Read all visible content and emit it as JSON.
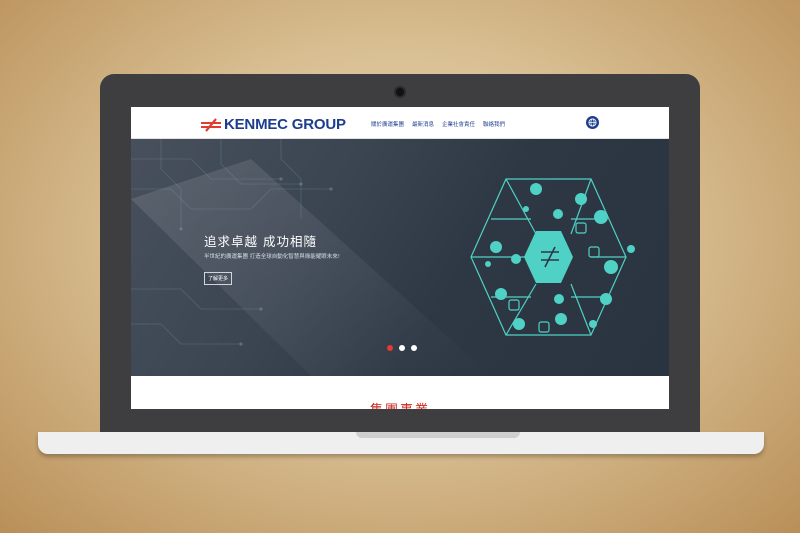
{
  "header": {
    "logo_text": "KENMEC GROUP",
    "nav": [
      "關於廣運集團",
      "最新消息",
      "企業社會責任",
      "聯絡我們"
    ]
  },
  "hero": {
    "headline": "追求卓越 成功相隨",
    "subtitle": "半世紀的廣運集團 打造全球自動化智慧與綠能耀眼未來!",
    "button_label": "了解更多",
    "slides": 3,
    "active_slide": 1
  },
  "section": {
    "heading": "集團事業"
  },
  "colors": {
    "brand_blue": "#1d3d8f",
    "brand_red": "#e23b30",
    "network_cyan": "#4fd1c5"
  },
  "icons": [
    "globe-icon",
    "kenmec-logo-mark",
    "network-hexagon-graphic"
  ]
}
